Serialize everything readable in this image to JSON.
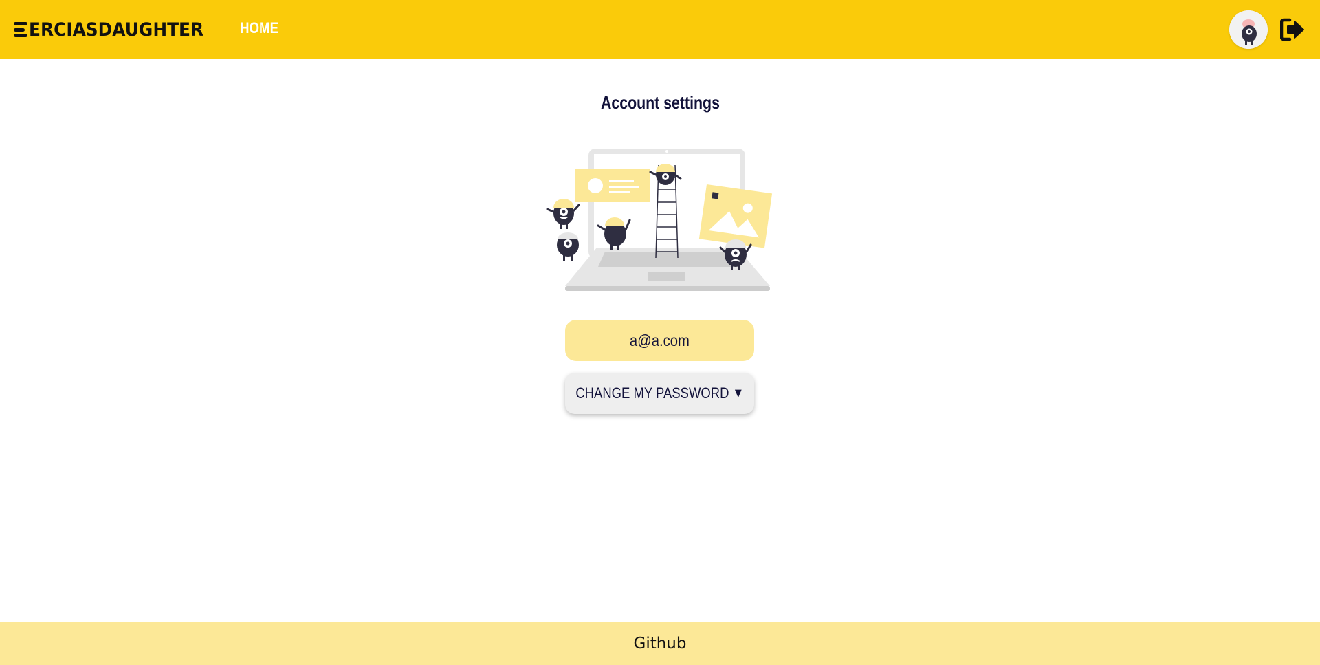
{
  "header": {
    "brand": "ERCIASDAUGHTER",
    "nav_home": "HOME",
    "avatar_icon": "user-avatar-icon",
    "logout_icon": "logout-icon"
  },
  "main": {
    "title": "Account settings",
    "illustration": "under-construction-illustration",
    "email": "a@a.com",
    "change_password_label": "CHANGE MY PASSWORD",
    "change_password_caret": "▼"
  },
  "footer": {
    "link": "Github"
  },
  "colors": {
    "header_bg": "#facb0a",
    "accent_light": "#fce897",
    "text_dark": "#12123a",
    "button_bg": "#eeeeee"
  }
}
